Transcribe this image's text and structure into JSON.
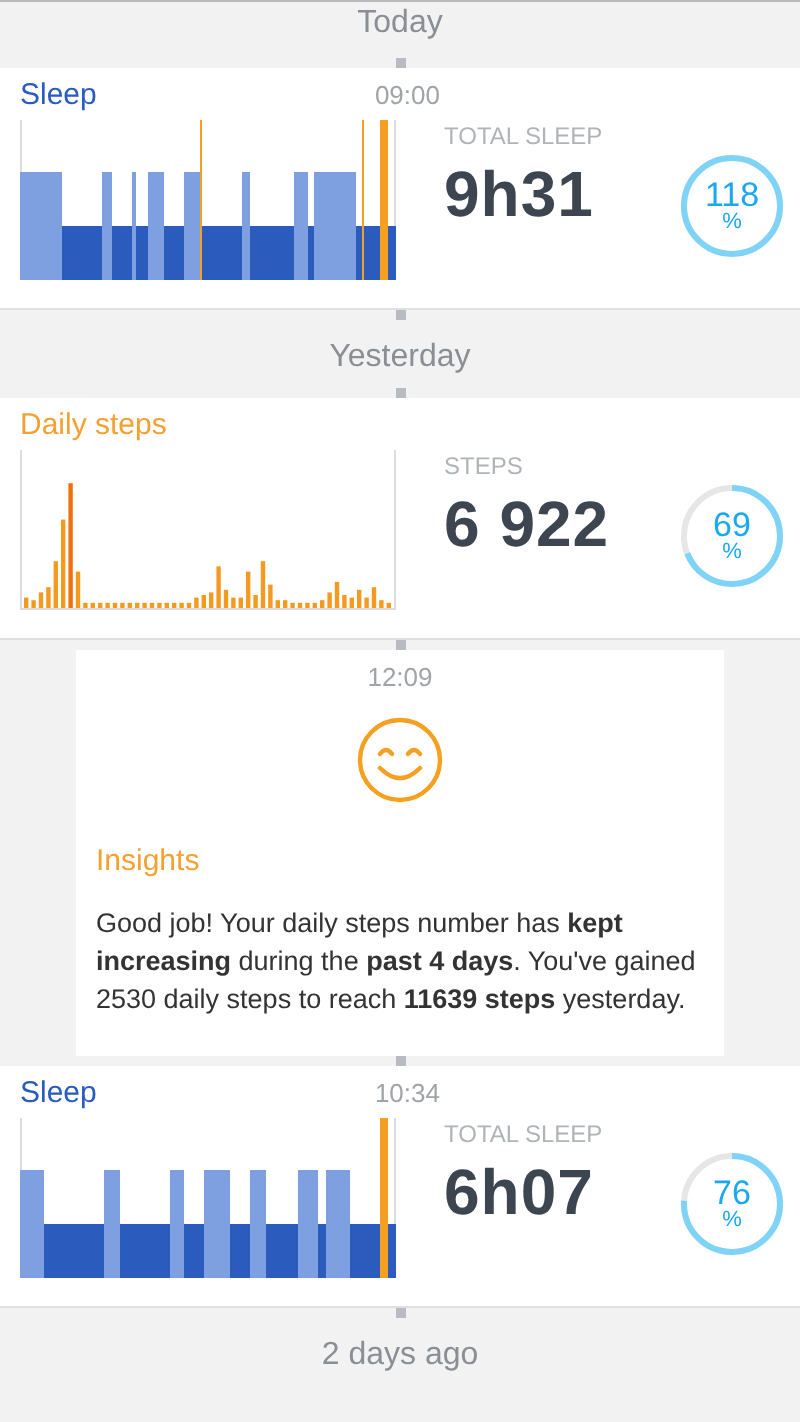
{
  "timeline": [
    {
      "kind": "day",
      "label": "Today"
    },
    {
      "kind": "sleep",
      "title": "Sleep",
      "time": "09:00",
      "stat_label": "TOTAL SLEEP",
      "value": "9h31",
      "percent": "118",
      "unit": "%",
      "level": 1
    },
    {
      "kind": "day",
      "label": "Yesterday"
    },
    {
      "kind": "steps",
      "title": "Daily steps",
      "stat_label": "STEPS",
      "value": "6 922",
      "percent": "69",
      "unit": "%",
      "level": 0.69
    },
    {
      "kind": "insight",
      "time": "12:09",
      "title": "Insights",
      "text": "Good job! Your daily steps number has **kept increasing** during the **past 4 days**. You've gained 2530 daily steps to reach **11639 steps** yesterday."
    },
    {
      "kind": "sleep",
      "title": "Sleep",
      "time": "10:34",
      "stat_label": "TOTAL SLEEP",
      "value": "6h07",
      "percent": "76",
      "unit": "%",
      "level": 0.76
    },
    {
      "kind": "day",
      "label": "2 days ago"
    }
  ]
}
